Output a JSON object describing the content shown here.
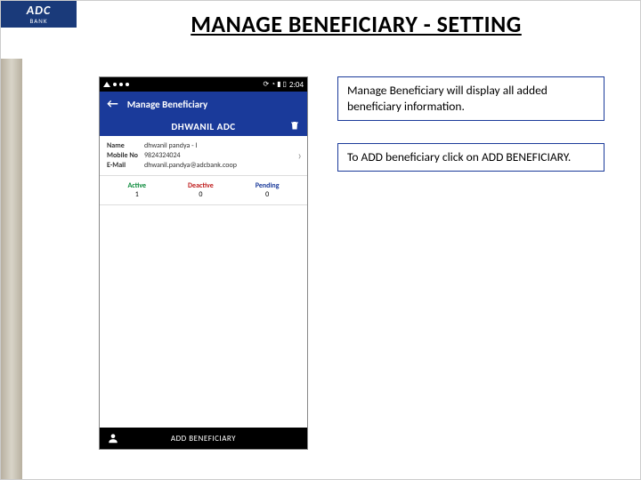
{
  "logo": {
    "name": "ADC",
    "sub": "BANK"
  },
  "page_title": "MANAGE BENEFICIARY - SETTING",
  "phone": {
    "status": {
      "time": "2:04"
    },
    "header": {
      "title": "Manage Beneficiary"
    },
    "beneficiary": {
      "name_bar": "DHWANIL ADC",
      "labels": {
        "name": "Name",
        "mobile": "Mobile No",
        "email": "E-Mail"
      },
      "values": {
        "name": "dhwanil pandya - I",
        "mobile": "9824324024",
        "email": "dhwanil.pandya@adcbank.coop"
      }
    },
    "status_counts": {
      "active_label": "Active",
      "active_count": "1",
      "deactive_label": "Deactive",
      "deactive_count": "0",
      "pending_label": "Pending",
      "pending_count": "0"
    },
    "footer": {
      "add_beneficiary": "ADD BENEFICIARY"
    }
  },
  "callouts": {
    "c1": "Manage Beneficiary will display all added beneficiary information.",
    "c2": "To ADD beneficiary click on ADD BENEFICIARY."
  }
}
